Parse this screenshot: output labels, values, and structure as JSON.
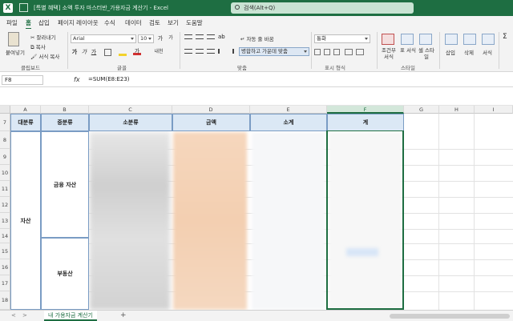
{
  "window": {
    "title": "[특별 혜택] 소액 투자 마스터반_가용자금 계산기 - Excel",
    "search_placeholder": "검색(Alt+Q)",
    "app_icon": "X"
  },
  "ribbon_tabs": [
    "파일",
    "홈",
    "삽입",
    "페이지 레이아웃",
    "수식",
    "데이터",
    "검토",
    "보기",
    "도움말"
  ],
  "active_tab": "홈",
  "ribbon": {
    "clipboard": {
      "paste": "붙여넣기",
      "cut": "잘라내기",
      "copy": "복사",
      "format_painter": "서식 복사",
      "label": "클립보드"
    },
    "font": {
      "font_name": "Arial",
      "font_size": "10",
      "grow": "가",
      "shrink": "가",
      "bold": "가",
      "italic": "가",
      "underline": "가",
      "font_color": "가",
      "pinyin": "내천",
      "label": "글꼴"
    },
    "alignment": {
      "wrap_text": "자동 줄 바꿈",
      "merge_center": "병합하고 가운데 맞춤",
      "label": "맞춤"
    },
    "number": {
      "format": "통화",
      "label": "표시 형식"
    },
    "styles": {
      "conditional": "조건부 서식",
      "table": "표 서식",
      "cell_styles": "셀 스타일",
      "label": "스타일"
    },
    "cells": {
      "insert": "삽입",
      "delete": "삭제",
      "format": "서식"
    },
    "editing": {
      "sum": "Σ"
    }
  },
  "formula_bar": {
    "name_box": "F8",
    "fx": "fx",
    "formula": "=SUM(E8:E23)"
  },
  "columns": [
    "A",
    "B",
    "C",
    "D",
    "E",
    "F",
    "G",
    "H",
    "I"
  ],
  "selected_column": "F",
  "rows": [
    "7",
    "8",
    "9",
    "10",
    "11",
    "12",
    "13",
    "14",
    "15",
    "16",
    "17",
    "18"
  ],
  "table_header": [
    "대분류",
    "중분류",
    "소분류",
    "금액",
    "소계",
    "계"
  ],
  "merged_cells": {
    "major": "자산",
    "mid_1": "금융 자산",
    "mid_2": "부동산"
  },
  "sheet": {
    "tab_name": "내 가용자금 계산기",
    "add": "+",
    "prev": "<",
    "next": ">"
  }
}
